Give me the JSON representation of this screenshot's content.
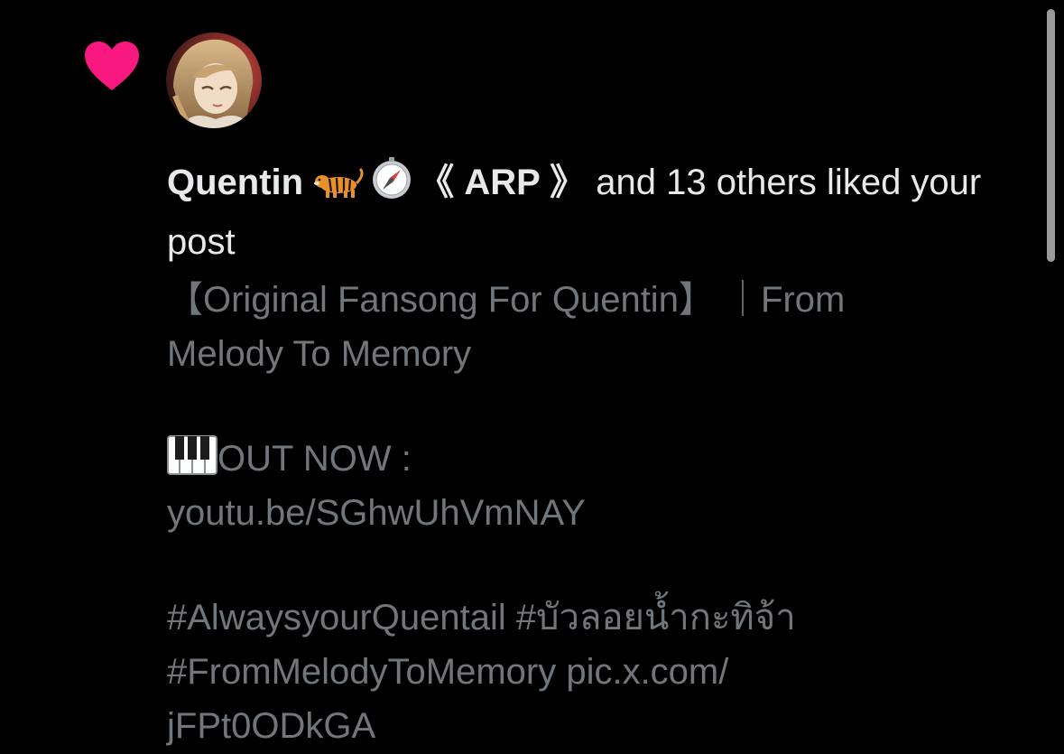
{
  "notification": {
    "type_icon": "heart-icon",
    "heart_color": "#f91880",
    "avatar": "user-avatar",
    "actor_name": "Quentin",
    "actor_emojis": [
      "tiger-emoji",
      "compass-emoji"
    ],
    "actor_tag": "《 ARP 》",
    "action_text": " and 13 others liked your post"
  },
  "post": {
    "line1": "【Original Fansong For Quentin】 ｜From",
    "line2": "Melody To Memory",
    "piano_icon": "piano-emoji",
    "line3": "OUT NOW :",
    "line4": "youtu.be/SGhwUhVmNAY",
    "line5": "#AlwaysyourQuentail #บัวลอยน้ำกะทิจ้า",
    "line6": "#FromMelodyToMemory pic.x.com/",
    "line7": "jFPt0ODkGA"
  },
  "colors": {
    "background": "#000000",
    "primary_text": "#e7e9ea",
    "secondary_text": "#71767b",
    "heart": "#f91880"
  }
}
